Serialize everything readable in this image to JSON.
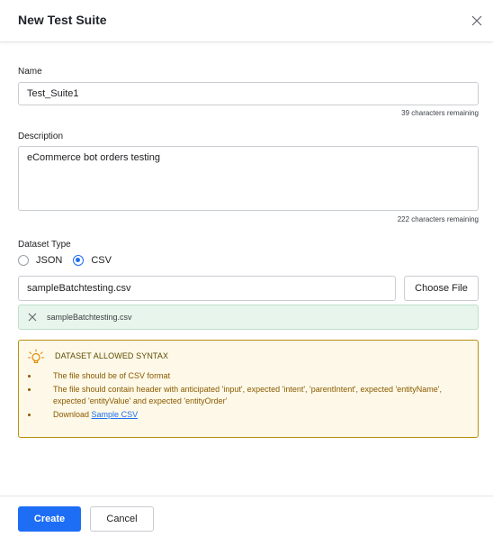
{
  "dialog": {
    "title": "New Test Suite"
  },
  "name_field": {
    "label": "Name",
    "value": "Test_Suite1",
    "counter": "39 characters remaining"
  },
  "description_field": {
    "label": "Description",
    "value": "eCommerce bot orders testing",
    "counter": "222 characters remaining"
  },
  "dataset_type": {
    "label": "Dataset Type",
    "options": [
      {
        "label": "JSON",
        "selected": false
      },
      {
        "label": "CSV",
        "selected": true
      }
    ]
  },
  "file_input": {
    "value": "sampleBatchtesting.csv",
    "button_label": "Choose File"
  },
  "uploaded_file": {
    "name": "sampleBatchtesting.csv"
  },
  "syntax_box": {
    "heading": "DATASET ALLOWED SYNTAX",
    "items": [
      "The file should be of CSV format",
      "The file should contain header with anticipated 'input', expected 'intent', 'parentIntent', expected 'entityName', expected 'entityValue' and expected 'entityOrder'"
    ],
    "download_prefix": "Download",
    "download_link": "Sample CSV"
  },
  "footer": {
    "create_label": "Create",
    "cancel_label": "Cancel"
  },
  "colors": {
    "primary": "#1d6ef5",
    "success_bg": "#e8f5ec",
    "warning_border": "#b8900f",
    "warning_bg": "#fdf8e7"
  }
}
